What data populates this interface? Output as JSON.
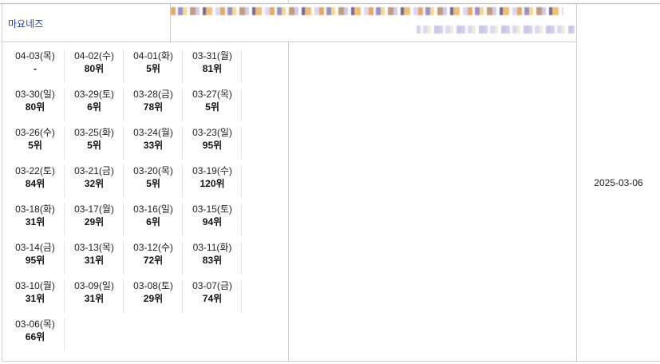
{
  "product": {
    "name": "마요네즈"
  },
  "registered_date": "2025-03-06",
  "rank_days": [
    {
      "date": "04-03(목)",
      "rank": "-"
    },
    {
      "date": "04-02(수)",
      "rank": "80위"
    },
    {
      "date": "04-01(화)",
      "rank": "5위"
    },
    {
      "date": "03-31(월)",
      "rank": "81위"
    },
    {
      "date": "03-30(일)",
      "rank": "80위"
    },
    {
      "date": "03-29(토)",
      "rank": "6위"
    },
    {
      "date": "03-28(금)",
      "rank": "78위"
    },
    {
      "date": "03-27(목)",
      "rank": "5위"
    },
    {
      "date": "03-26(수)",
      "rank": "5위"
    },
    {
      "date": "03-25(화)",
      "rank": "5위"
    },
    {
      "date": "03-24(월)",
      "rank": "33위"
    },
    {
      "date": "03-23(일)",
      "rank": "95위"
    },
    {
      "date": "03-22(토)",
      "rank": "84위"
    },
    {
      "date": "03-21(금)",
      "rank": "32위"
    },
    {
      "date": "03-20(목)",
      "rank": "5위"
    },
    {
      "date": "03-19(수)",
      "rank": "120위"
    },
    {
      "date": "03-18(화)",
      "rank": "31위"
    },
    {
      "date": "03-17(월)",
      "rank": "29위"
    },
    {
      "date": "03-16(일)",
      "rank": "6위"
    },
    {
      "date": "03-15(토)",
      "rank": "94위"
    },
    {
      "date": "03-14(금)",
      "rank": "95위"
    },
    {
      "date": "03-13(목)",
      "rank": "31위"
    },
    {
      "date": "03-12(수)",
      "rank": "72위"
    },
    {
      "date": "03-11(화)",
      "rank": "83위"
    },
    {
      "date": "03-10(월)",
      "rank": "31위"
    },
    {
      "date": "03-09(일)",
      "rank": "31위"
    },
    {
      "date": "03-08(토)",
      "rank": "29위"
    },
    {
      "date": "03-07(금)",
      "rank": "74위"
    },
    {
      "date": "03-06(목)",
      "rank": "66위"
    }
  ]
}
